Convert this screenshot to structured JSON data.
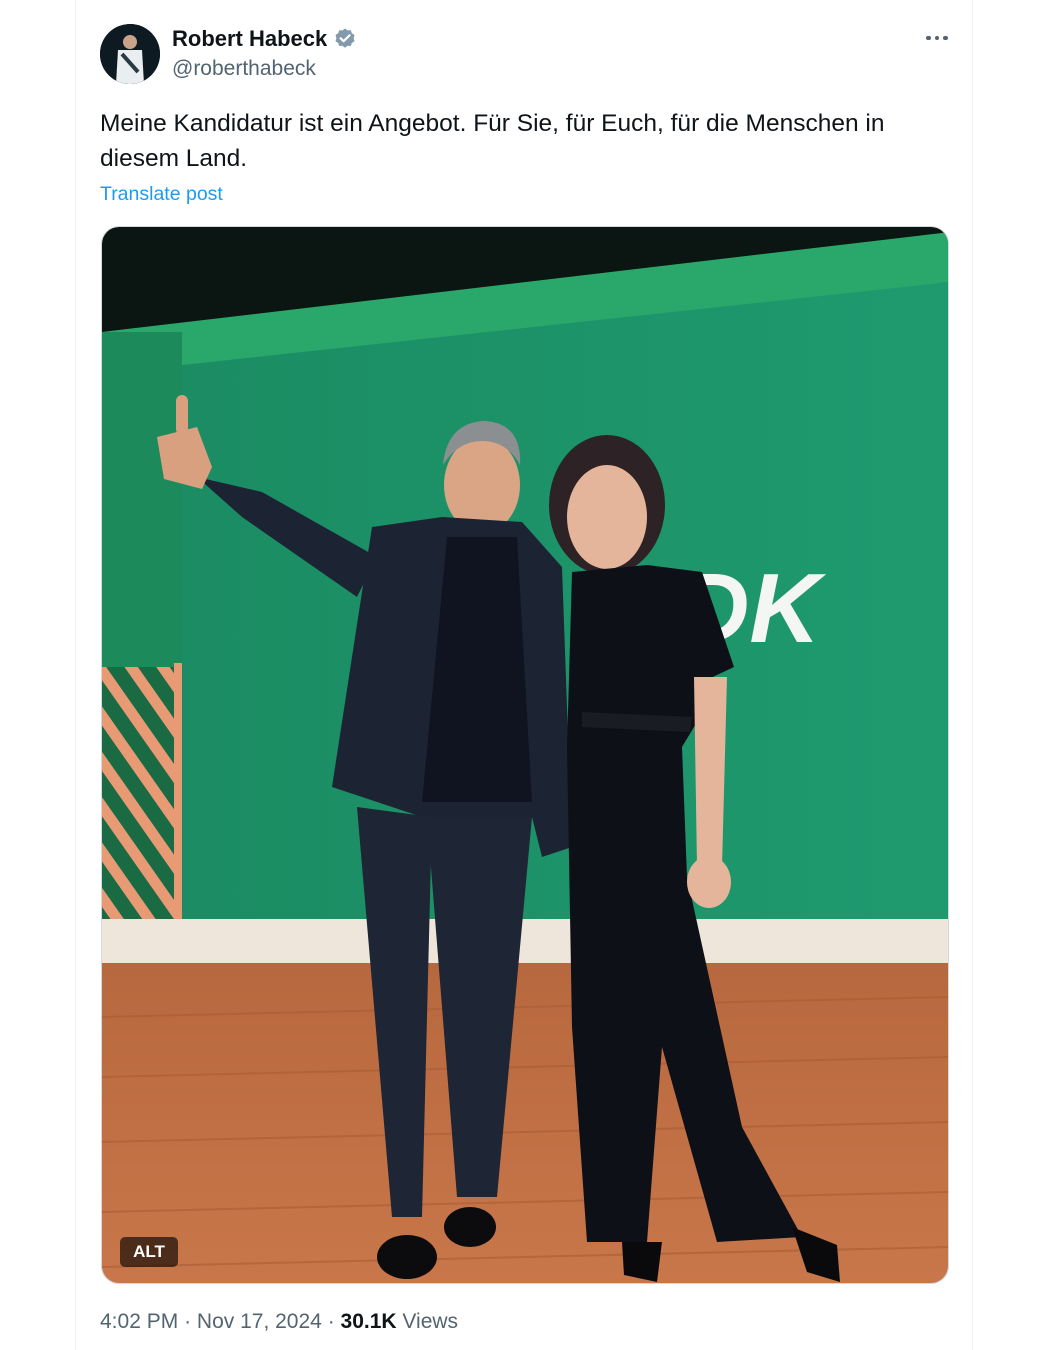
{
  "author": {
    "name": "Robert Habeck",
    "handle": "@roberthabeck",
    "verified_icon": "verified-badge-icon"
  },
  "tweet": {
    "text": "Meine Kandidatur ist ein Angebot. Für Sie, für Euch, für die Menschen in diesem Land.",
    "translate_label": "Translate post"
  },
  "media": {
    "backdrop_text": "BDK",
    "alt_label": "ALT"
  },
  "meta": {
    "time": "4:02 PM",
    "date": "Nov 17, 2024",
    "views_count": "30.1K",
    "views_label": "Views",
    "separator": "·"
  },
  "colors": {
    "accent": "#1d9bf0",
    "verified": "#829aab",
    "stage_green": "#1e9a6c",
    "text_secondary": "#536471"
  }
}
